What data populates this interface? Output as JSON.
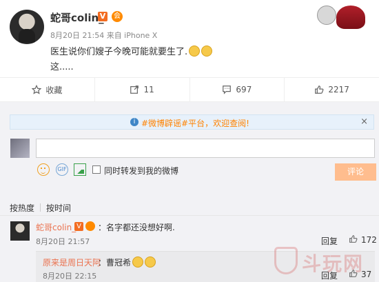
{
  "post": {
    "author": "蛇哥colin_",
    "verified_badge": "V",
    "vip_badge": "会",
    "timestamp": "8月20日 21:54 来自 iPhone X",
    "text_line1": "医生说你们嫂子今晚可能就要生了.",
    "text_line2": "这.....",
    "emoji": "doge-icon"
  },
  "actions": {
    "favorite_label": "收藏",
    "repost_count": "11",
    "comment_count": "697",
    "like_count": "2217"
  },
  "comments_panel": {
    "notice_icon": "i",
    "notice_text": "#微博辟谣#平台，欢迎查阅!",
    "notice_close": "×",
    "repost_checkbox_label": "同时转发到我的微博",
    "submit_button": "评论",
    "sort_hot": "按热度",
    "sort_time": "按时间"
  },
  "comments": [
    {
      "author": "蛇哥colin_",
      "badge": "V",
      "text": "：名字都还没想好啊.",
      "date": "8月20日 21:57",
      "reply_label": "回复",
      "likes": "172"
    },
    {
      "author": "原来是周日天阿",
      "text": "：曹冠希",
      "date": "8月20日 22:15",
      "reply_label": "回复",
      "likes": "37"
    }
  ],
  "watermark": "斗玩网",
  "colors": {
    "accent_orange": "#eb7350",
    "submit_disabled": "#ffbd8e",
    "notice_blue": "#e7f1fb"
  }
}
